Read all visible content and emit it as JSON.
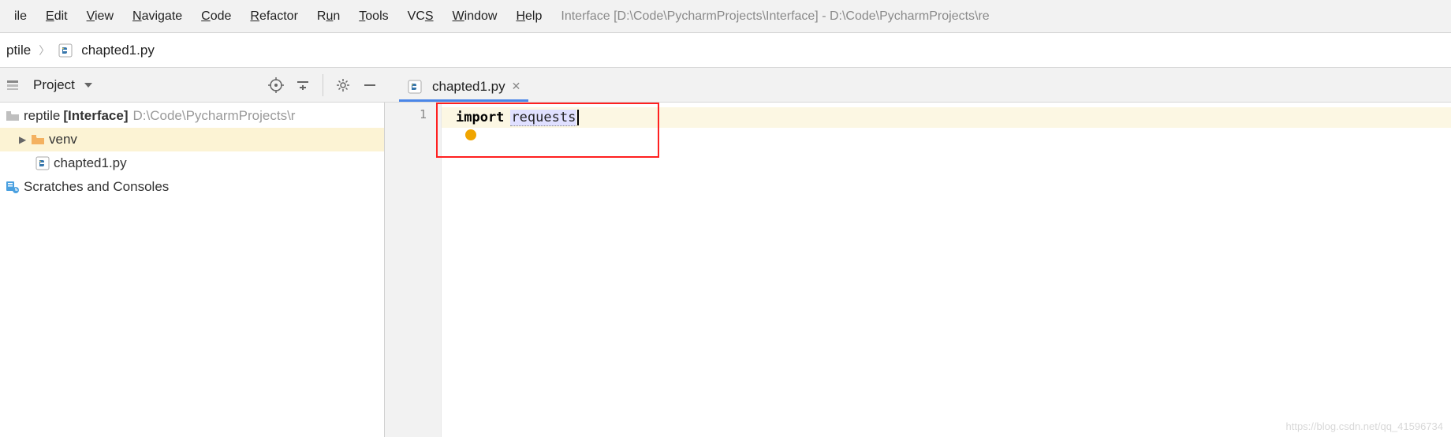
{
  "menu": {
    "items": [
      {
        "label": "ile",
        "u": ""
      },
      {
        "label": "Edit",
        "u": "E"
      },
      {
        "label": "View",
        "u": "V"
      },
      {
        "label": "Navigate",
        "u": "N"
      },
      {
        "label": "Code",
        "u": "C"
      },
      {
        "label": "Refactor",
        "u": "R"
      },
      {
        "label": "Run",
        "u": "u"
      },
      {
        "label": "Tools",
        "u": "T"
      },
      {
        "label": "VCS",
        "u": "S"
      },
      {
        "label": "Window",
        "u": "W"
      },
      {
        "label": "Help",
        "u": "H"
      }
    ],
    "title": "Interface [D:\\Code\\PycharmProjects\\Interface] - D:\\Code\\PycharmProjects\\re"
  },
  "breadcrumb": {
    "items": [
      "ptile",
      "chapted1.py"
    ]
  },
  "project_header": {
    "label": "Project"
  },
  "tabs": {
    "active": "chapted1.py"
  },
  "tree": {
    "root": {
      "name": "reptile",
      "qualifier": "[Interface]",
      "path": "D:\\Code\\PycharmProjects\\r"
    },
    "venv": "venv",
    "file1": "chapted1.py",
    "scratches": "Scratches and Consoles"
  },
  "editor": {
    "line_number": "1",
    "keyword": "import",
    "module": "requests"
  },
  "watermark": "https://blog.csdn.net/qq_41596734"
}
